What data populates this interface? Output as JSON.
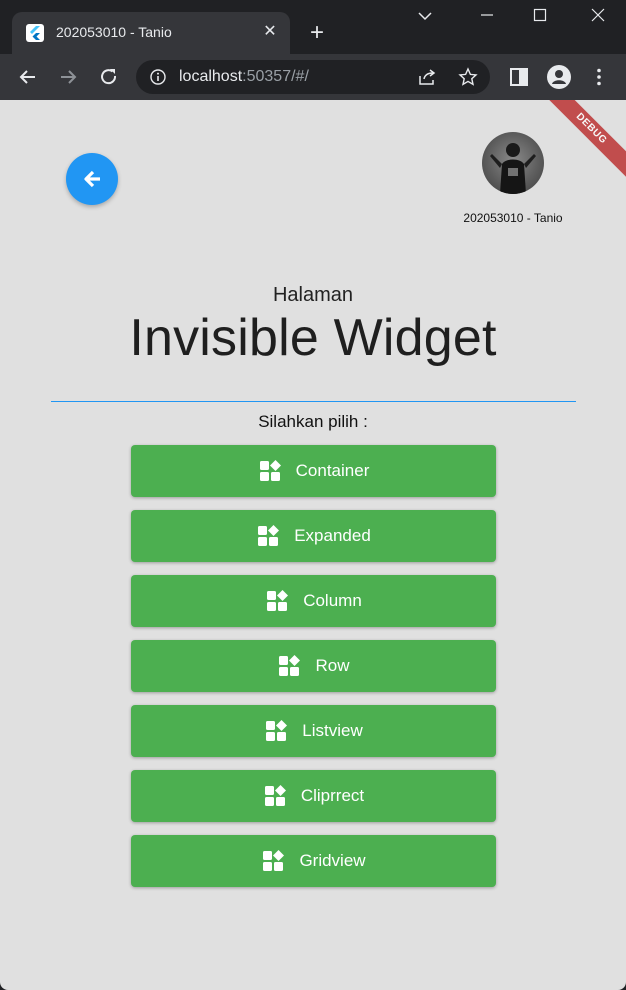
{
  "browser": {
    "tab_title": "202053010 - Tanio",
    "url_host": "localhost",
    "url_rest": ":50357/#/"
  },
  "page": {
    "profile_name": "202053010 - Tanio",
    "subtitle": "Halaman",
    "title": "Invisible Widget",
    "prompt": "Silahkan pilih :",
    "debug_label": "DEBUG",
    "buttons": [
      {
        "label": "Container"
      },
      {
        "label": "Expanded"
      },
      {
        "label": "Column"
      },
      {
        "label": "Row"
      },
      {
        "label": "Listview"
      },
      {
        "label": "Cliprrect"
      },
      {
        "label": "Gridview"
      }
    ]
  },
  "colors": {
    "accent_blue": "#2196f3",
    "button_green": "#4caf50",
    "page_bg": "#e0e0e0"
  }
}
